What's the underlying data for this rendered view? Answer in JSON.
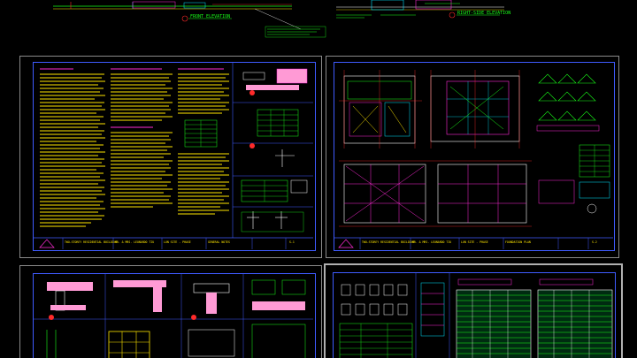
{
  "top_strip": {
    "labels": {
      "front_elevation": "FRONT ELEVATION",
      "right_side_elevation": "RIGHT-SIDE ELEVATION"
    }
  },
  "sheets": [
    {
      "id": "S-1",
      "title_block": {
        "project": "TWO-STOREY RESIDENTIAL BUILDING",
        "owner": "MR. & MRS. LEONARDO TIU",
        "location": "LUN SITE - PHASE",
        "sheet_title": "GENERAL NOTES",
        "drawing_no": "S-1"
      }
    },
    {
      "id": "S-2",
      "title_block": {
        "project": "TWO-STOREY RESIDENTIAL BUILDING",
        "owner": "MR. & MRS. LEONARDO TIU",
        "location": "LUN SITE - PHASE",
        "sheet_title": "FOUNDATION PLAN",
        "drawing_no": "S-2"
      }
    },
    {
      "id": "S-3",
      "title_block": {}
    },
    {
      "id": "S-4",
      "title_block": {}
    }
  ],
  "colors": {
    "background": "#000000",
    "sheet_border": "#8a8a8a",
    "frame": "#3f5bff",
    "text_yellow": "#ffe600",
    "line_green": "#19ff19",
    "line_cyan": "#00e5ff",
    "line_magenta": "#ff2bd6",
    "line_red": "#ff2a2a",
    "line_white": "#ffffff"
  }
}
